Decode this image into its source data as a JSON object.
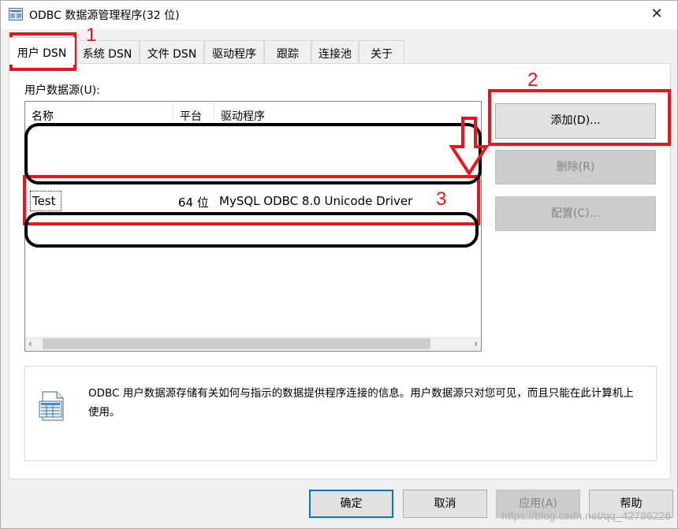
{
  "window": {
    "title": "ODBC 数据源管理程序(32 位)",
    "close_glyph": "✕"
  },
  "tabs": [
    {
      "label": "用户 DSN",
      "active": true
    },
    {
      "label": "系统 DSN",
      "active": false
    },
    {
      "label": "文件 DSN",
      "active": false
    },
    {
      "label": "驱动程序",
      "active": false
    },
    {
      "label": "跟踪",
      "active": false
    },
    {
      "label": "连接池",
      "active": false
    },
    {
      "label": "关于",
      "active": false
    }
  ],
  "user_dsn": {
    "section_label": "用户数据源(U):",
    "columns": [
      "名称",
      "平台",
      "驱动程序"
    ],
    "rows": [
      {
        "name": "Test",
        "platform": "64 位",
        "driver": "MySQL ODBC 8.0 Unicode Driver"
      }
    ],
    "buttons": {
      "add": "添加(D)...",
      "remove": "删除(R)",
      "configure": "配置(C)..."
    },
    "info_text": "ODBC 用户数据源存储有关如何与指示的数据提供程序连接的信息。用户数据源只对您可见，而且只能在此计算机上使用。"
  },
  "footer_buttons": {
    "ok": "确定",
    "cancel": "取消",
    "apply": "应用(A)",
    "help": "帮助"
  },
  "annotations": {
    "n1": "1",
    "n2": "2",
    "n3": "3",
    "color": "#e8151d"
  },
  "watermark": "https://blog.csdn.net/qq_42786226"
}
